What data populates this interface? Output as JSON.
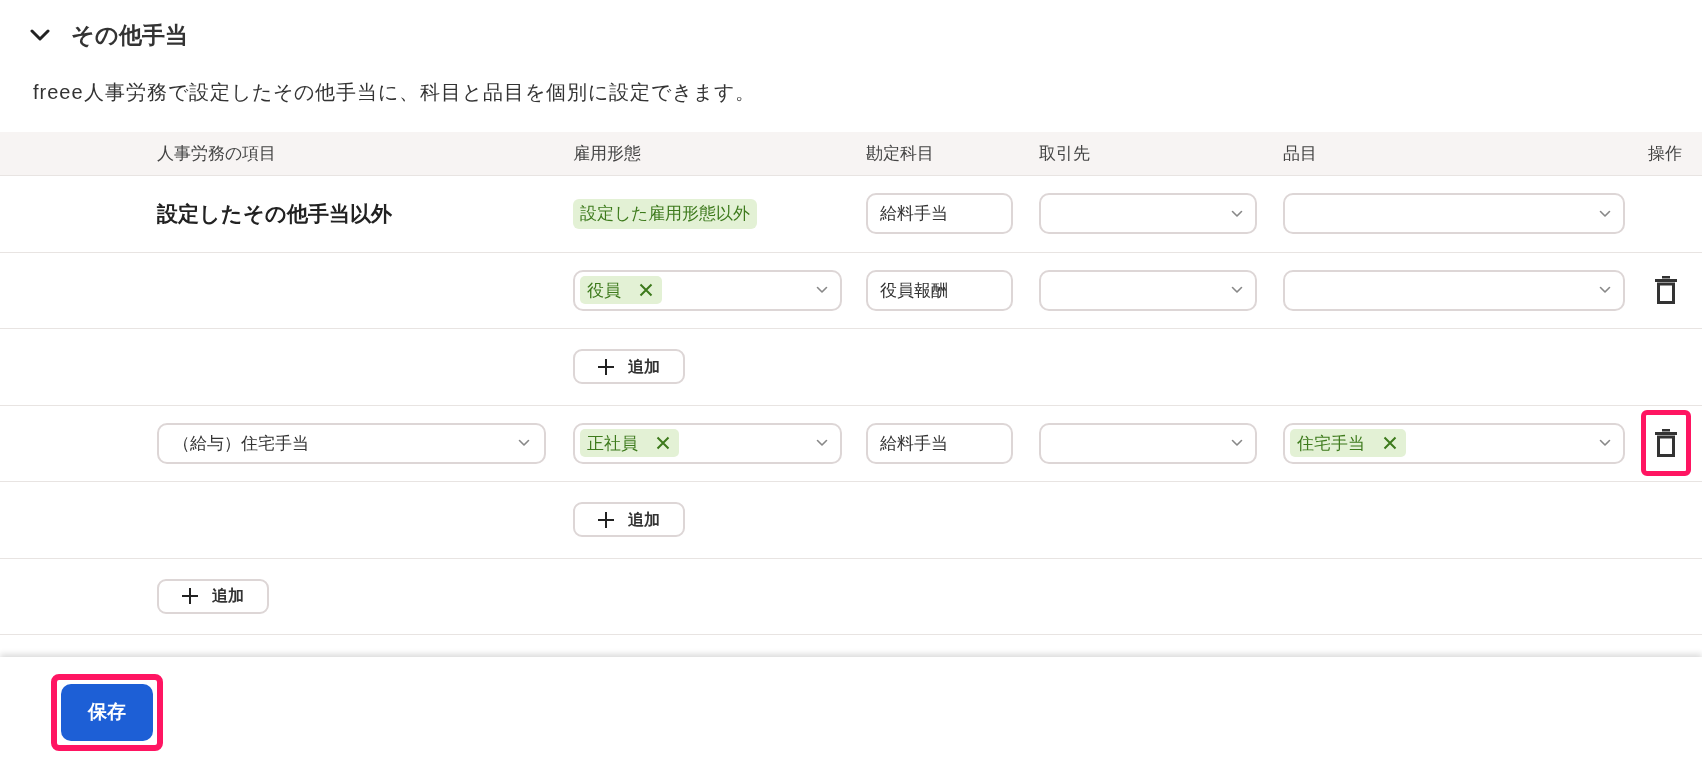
{
  "section": {
    "title": "その他手当",
    "expanded": true,
    "description": "freee人事労務で設定したその他手当に、科目と品目を個別に設定できます。"
  },
  "table": {
    "columns": [
      "人事労務の項目",
      "雇用形態",
      "勘定科目",
      "取引先",
      "品目",
      "操作"
    ],
    "rows": [
      {
        "kind": "entry",
        "item": {
          "kind": "label",
          "text": "設定したその他手当以外"
        },
        "employment": {
          "kind": "fixed",
          "tags": [
            "設定した雇用形態以外"
          ]
        },
        "account": "給料手当",
        "deletable": false,
        "delete_highlighted": false
      },
      {
        "kind": "entry",
        "employment": {
          "kind": "select",
          "tags": [
            "役員"
          ]
        },
        "account": "役員報酬",
        "deletable": true,
        "delete_highlighted": false
      },
      {
        "kind": "add",
        "employment": {
          "kind": "add",
          "label": "追加"
        }
      },
      {
        "kind": "entry",
        "item": {
          "kind": "select",
          "value": "（給与）住宅手当"
        },
        "employment": {
          "kind": "select",
          "tags": [
            "正社員"
          ]
        },
        "account": "給料手当",
        "product_tags": [
          "住宅手当"
        ],
        "deletable": true,
        "delete_highlighted": true
      },
      {
        "kind": "add",
        "employment": {
          "kind": "add",
          "label": "追加"
        }
      },
      {
        "kind": "add",
        "item": {
          "kind": "add",
          "label": "追加"
        }
      }
    ]
  },
  "footer": {
    "save_button": {
      "label": "保存",
      "highlighted": true
    }
  }
}
